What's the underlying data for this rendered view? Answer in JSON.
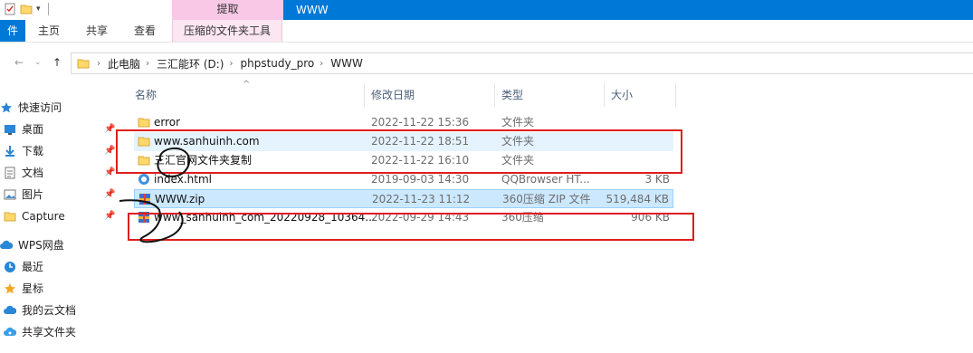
{
  "window": {
    "title": "WWW",
    "context_tab": "提取"
  },
  "ribbon": {
    "file": "件",
    "tabs": [
      "主页",
      "共享",
      "查看",
      "压缩的文件夹工具"
    ]
  },
  "address": {
    "crumbs": [
      "此电脑",
      "三汇能环 (D:)",
      "phpstudy_pro",
      "WWW"
    ]
  },
  "sidebar": {
    "quick_access": "快速访问",
    "items": [
      {
        "label": "桌面",
        "icon": "desktop-icon"
      },
      {
        "label": "下载",
        "icon": "download-icon"
      },
      {
        "label": "文档",
        "icon": "document-icon"
      },
      {
        "label": "图片",
        "icon": "picture-icon"
      },
      {
        "label": "Capture",
        "icon": "folder-icon"
      }
    ],
    "wps": "WPS网盘",
    "wps_items": [
      {
        "label": "最近",
        "icon": "clock-icon"
      },
      {
        "label": "星标",
        "icon": "star-icon"
      },
      {
        "label": "我的云文档",
        "icon": "cloud-icon"
      },
      {
        "label": "共享文件夹",
        "icon": "share-cloud-icon"
      }
    ]
  },
  "columns": {
    "name": "名称",
    "date": "修改日期",
    "type": "类型",
    "size": "大小"
  },
  "files": [
    {
      "name": "error",
      "date": "2022-11-22 15:36",
      "type": "文件夹",
      "size": "",
      "icon": "folder-icon"
    },
    {
      "name": "www.sanhuinh.com",
      "date": "2022-11-22 18:51",
      "type": "文件夹",
      "size": "",
      "icon": "folder-icon"
    },
    {
      "name": "三汇官网文件夹复制",
      "date": "2022-11-22 16:10",
      "type": "文件夹",
      "size": "",
      "icon": "folder-icon"
    },
    {
      "name": "index.html",
      "date": "2019-09-03 14:30",
      "type": "QQBrowser HT...",
      "size": "3 KB",
      "icon": "html-icon"
    },
    {
      "name": "WWW.zip",
      "date": "2022-11-23 11:12",
      "type": "360压缩 ZIP 文件",
      "size": "519,484 KB",
      "icon": "zip-icon"
    },
    {
      "name": "www_sanhuinh_com_20220928_10364...",
      "date": "2022-09-29 14:43",
      "type": "360压缩",
      "size": "906 KB",
      "icon": "zip-icon"
    }
  ],
  "colors": {
    "accent": "#0078d7",
    "selection": "#cce8ff",
    "annotation": "#e01d1d"
  }
}
